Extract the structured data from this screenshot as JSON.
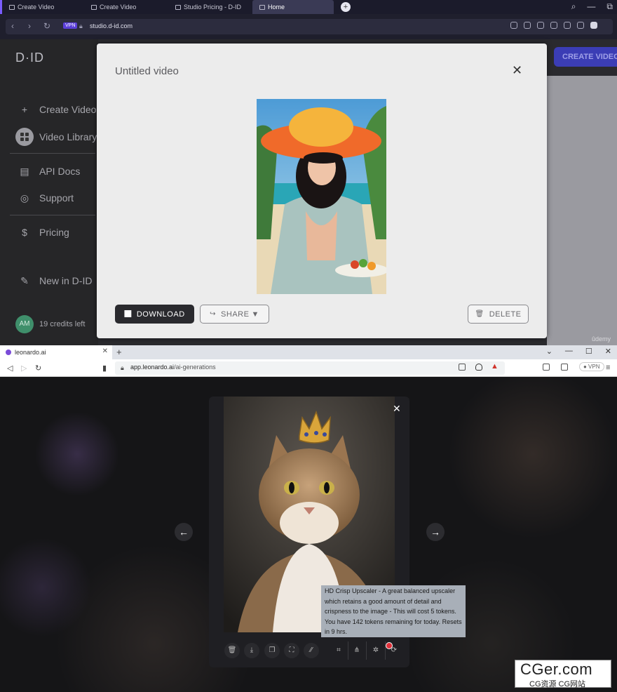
{
  "top_window": {
    "tabs": [
      {
        "label": "Create Video"
      },
      {
        "label": "Create Video"
      },
      {
        "label": "Studio Pricing - D-ID"
      },
      {
        "label": "Home"
      }
    ],
    "vpn_badge": "VPN",
    "url": "studio.d-id.com",
    "window_controls": {
      "search": "⌕",
      "minimize": "—",
      "restore": "⧉"
    },
    "did": {
      "logo": "D·ID",
      "sidebar": [
        {
          "label": "Create Video",
          "icon": "plus-icon"
        },
        {
          "label": "Video Library",
          "icon": "grid-icon"
        },
        {
          "label": "API Docs",
          "icon": "document-icon"
        },
        {
          "label": "Support",
          "icon": "lifebuoy-icon"
        },
        {
          "label": "Pricing",
          "icon": "dollar-icon"
        },
        {
          "label": "New in D-ID",
          "icon": "megaphone-icon"
        }
      ],
      "account": {
        "initials": "AM",
        "credits": "19 credits left"
      },
      "create_button": "CREATE VIDEO",
      "modal": {
        "title": "Untitled video",
        "close": "✕",
        "download_label": "DOWNLOAD",
        "share_label": "SHARE",
        "delete_label": "DELETE"
      }
    },
    "watermark": "ûdemy"
  },
  "bottom_window": {
    "tab": {
      "label": "leonardo.ai",
      "close": "✕"
    },
    "new_tab": "+",
    "window_controls": {
      "dropdown": "⌄",
      "minimize": "—",
      "maximize": "☐",
      "close": "✕"
    },
    "url_domain": "app.leonardo.ai",
    "url_path": "/ai-generations",
    "vpn_label": "● VPN",
    "viewer": {
      "close": "✕",
      "prev": "←",
      "next": "→",
      "tooltip": "HD Crisp Upscaler - A great balanced upscaler which retains a good amount of detail and crispness to the image - This will cost 5 tokens. You have 142 tokens remaining for today. Resets in 9 hrs."
    },
    "toolbar_icons": [
      "trash-icon",
      "download-icon",
      "copy-icon",
      "expand-icon",
      "remove-bg-icon",
      "crop-icon",
      "hd-icon",
      "upscale-icon",
      "crisp-upscale-icon"
    ]
  },
  "overlay_watermark": {
    "main": "CGer.com",
    "sub": "CG资源 CG网站"
  },
  "colors": {
    "d_id_accent": "#3b3db5",
    "vpn_purple": "#5b3fd8",
    "tooltip_bg": "#a8afb8"
  }
}
